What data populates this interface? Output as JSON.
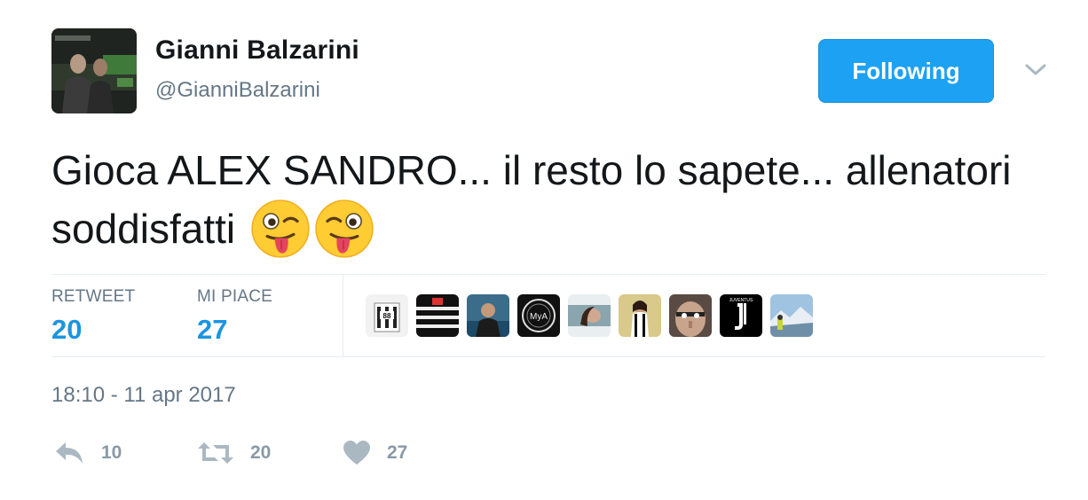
{
  "user": {
    "display_name": "Gianni Balzarini",
    "handle": "@GianniBalzarini"
  },
  "follow_button_label": "Following",
  "tweet": {
    "text": "Gioca ALEX SANDRO... il resto lo sapete... allenatori soddisfatti",
    "emojis": [
      "winking-face-with-tongue",
      "winking-face-with-tongue"
    ]
  },
  "stats": {
    "retweets_label": "RETWEET",
    "retweets_value": "20",
    "likes_label": "MI PIACE",
    "likes_value": "27"
  },
  "likers": [
    "liker-1",
    "liker-2",
    "liker-3",
    "liker-4",
    "liker-5",
    "liker-6",
    "liker-7",
    "liker-8",
    "liker-9"
  ],
  "timestamp": "18:10 - 11 apr 2017",
  "actions": {
    "reply_count": "10",
    "retweet_count": "20",
    "like_count": "27"
  },
  "colors": {
    "accent": "#1da1f2",
    "stat_value": "#1b95e0",
    "muted": "#657786",
    "action_icon": "#aab8c2"
  }
}
